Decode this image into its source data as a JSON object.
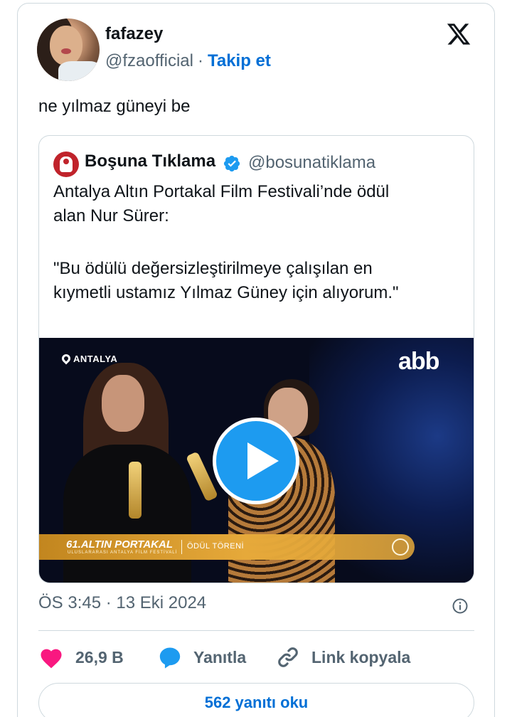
{
  "author": {
    "display_name": "fafazey",
    "handle": "@fzaofficial",
    "separator": "·",
    "follow_label": "Takip et"
  },
  "tweet": {
    "text": "ne yılmaz güneyi be",
    "timestamp": "ÖS 3:45 · 13 Eki 2024"
  },
  "quote": {
    "display_name": "Boşuna Tıklama",
    "handle": "@bosunatiklama",
    "lines": [
      "Antalya Altın Portakal Film Festivali’nde ödül",
      "alan Nur Sürer:",
      "\"Bu ödülü değersizleştirilmeye çalışılan en",
      "kıymetli ustamız Yılmaz Güney için alıyorum.\""
    ],
    "media": {
      "location_label": "ANTALYA",
      "channel_logo": "abb",
      "banner_title": "61.ALTIN PORTAKAL",
      "banner_subtitle": "ULUSLARARASI ANTALYA FİLM FESTİVALİ",
      "banner_caption": "ÖDÜL TÖRENİ"
    }
  },
  "actions": {
    "like_count": "26,9 B",
    "reply_label": "Yanıtla",
    "copy_link_label": "Link kopyala"
  },
  "read_replies_label": "562 yanıtı oku",
  "colors": {
    "link_blue": "#006fd6",
    "play_blue": "#1d9bf0",
    "like_pink": "#f91880",
    "verified_blue": "#1d9bf0",
    "muted": "#536471",
    "banner_gold": "#e6a93a"
  }
}
